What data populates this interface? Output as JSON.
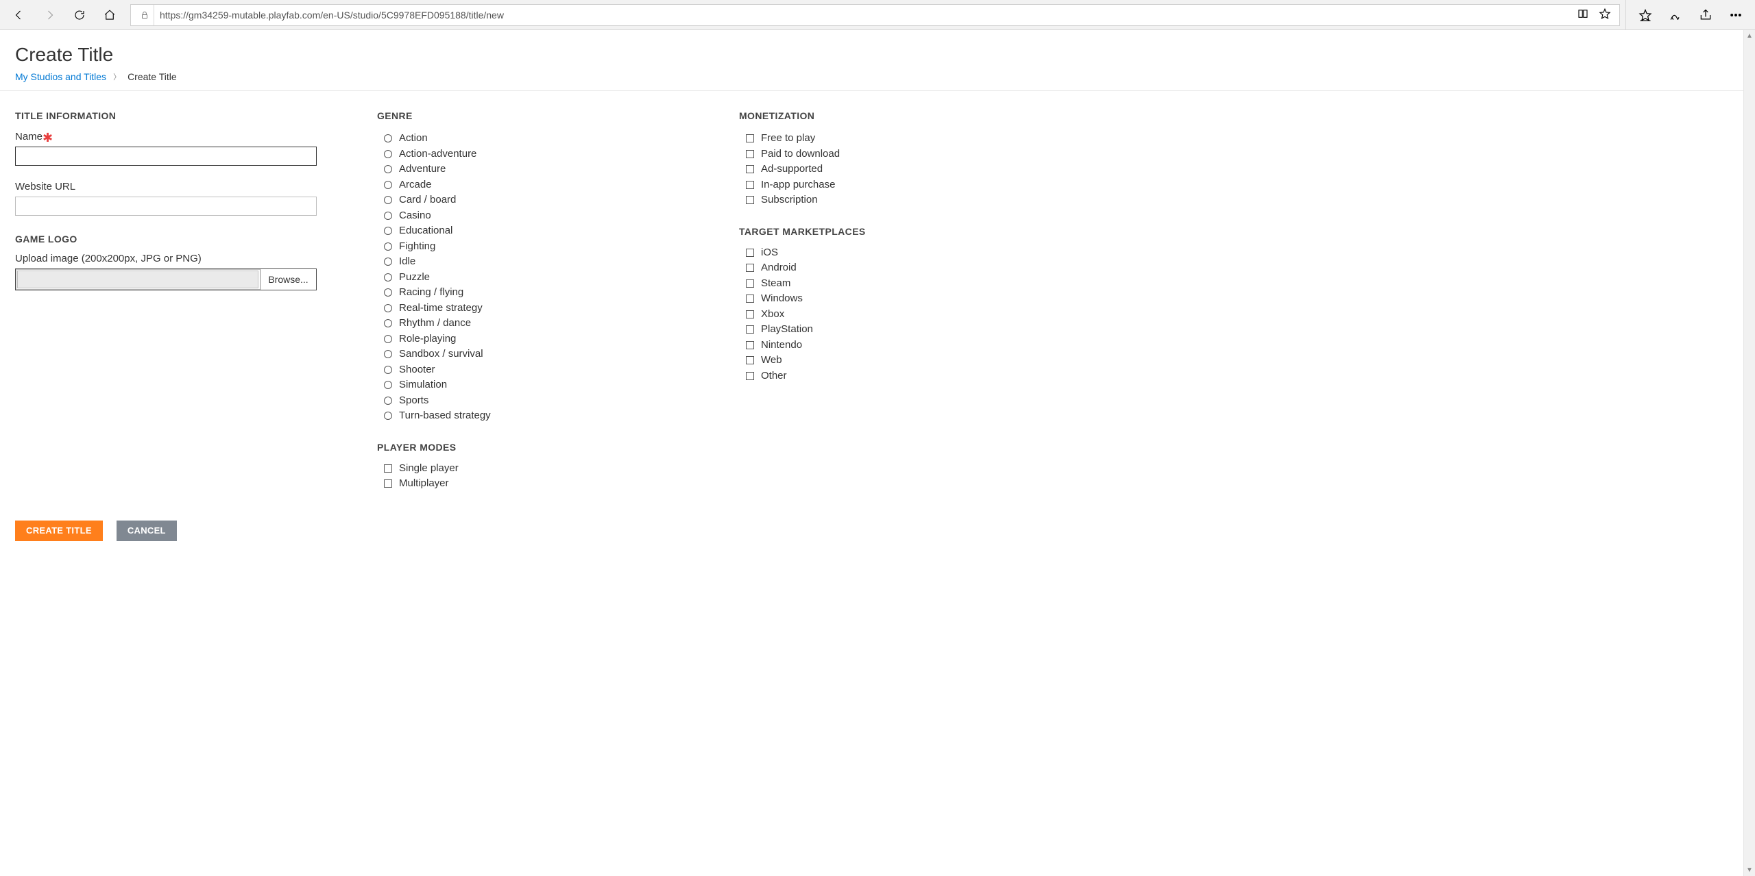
{
  "browser": {
    "url": "https://gm34259-mutable.playfab.com/en-US/studio/5C9978EFD095188/title/new"
  },
  "header": {
    "page_title": "Create Title",
    "breadcrumb_root": "My Studios and Titles",
    "breadcrumb_current": "Create Title"
  },
  "sections": {
    "title_info_heading": "TITLE INFORMATION",
    "name_label": "Name",
    "website_label": "Website URL",
    "game_logo_heading": "GAME LOGO",
    "upload_label": "Upload image (200x200px, JPG or PNG)",
    "browse_label": "Browse...",
    "genre_heading": "GENRE",
    "player_modes_heading": "PLAYER MODES",
    "monetization_heading": "MONETIZATION",
    "target_marketplaces_heading": "TARGET MARKETPLACES"
  },
  "genres": [
    "Action",
    "Action-adventure",
    "Adventure",
    "Arcade",
    "Card / board",
    "Casino",
    "Educational",
    "Fighting",
    "Idle",
    "Puzzle",
    "Racing / flying",
    "Real-time strategy",
    "Rhythm / dance",
    "Role-playing",
    "Sandbox / survival",
    "Shooter",
    "Simulation",
    "Sports",
    "Turn-based strategy"
  ],
  "player_modes": [
    "Single player",
    "Multiplayer"
  ],
  "monetization": [
    "Free to play",
    "Paid to download",
    "Ad-supported",
    "In-app purchase",
    "Subscription"
  ],
  "marketplaces": [
    "iOS",
    "Android",
    "Steam",
    "Windows",
    "Xbox",
    "PlayStation",
    "Nintendo",
    "Web",
    "Other"
  ],
  "buttons": {
    "create": "CREATE TITLE",
    "cancel": "CANCEL"
  }
}
